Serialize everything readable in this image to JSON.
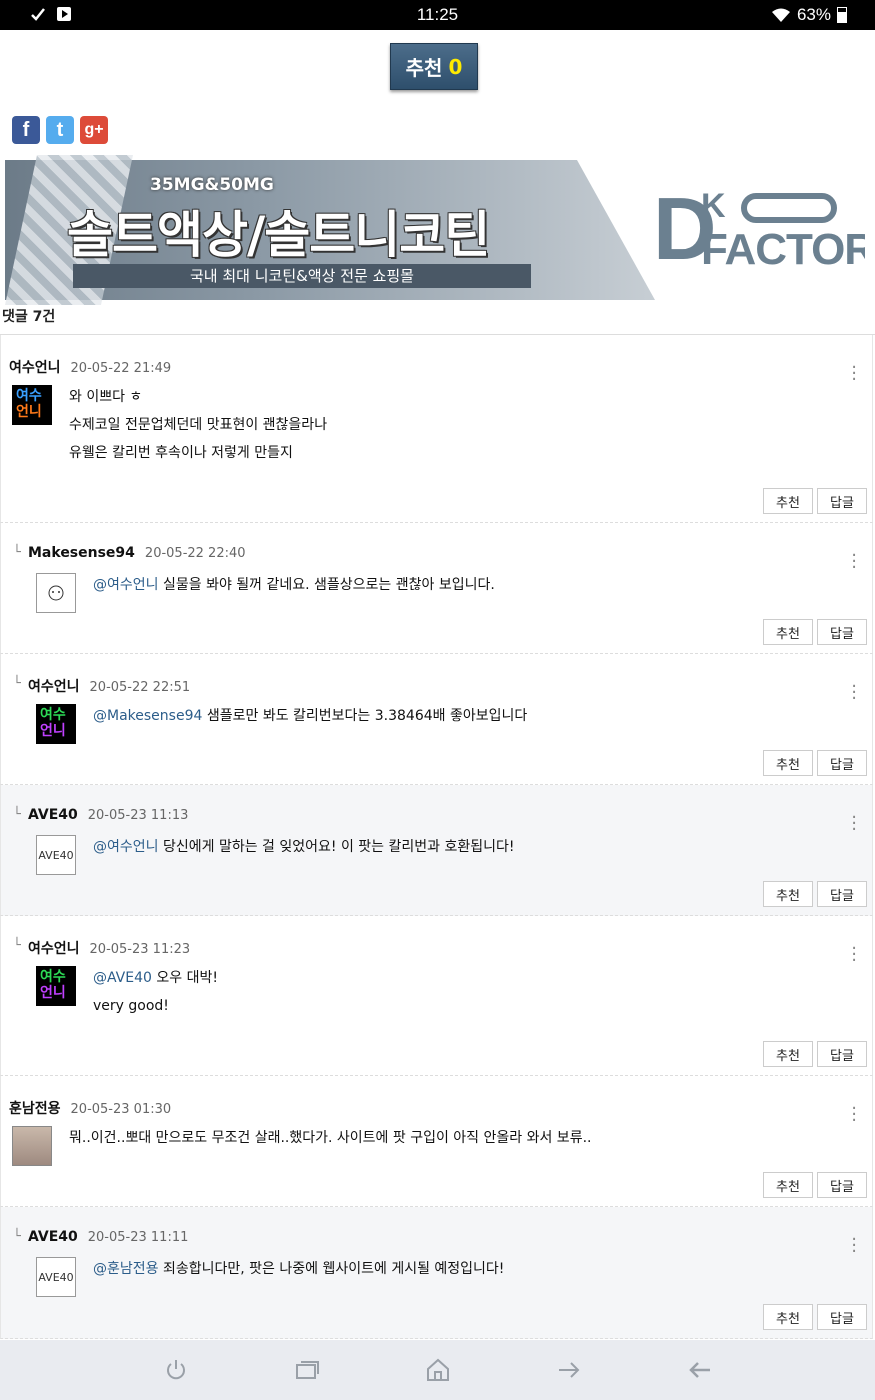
{
  "status_bar": {
    "time": "11:25",
    "battery": "63%"
  },
  "recommend_button": {
    "label": "추천",
    "count": "0"
  },
  "social": {
    "facebook": "f",
    "twitter": "t",
    "googleplus": "g+"
  },
  "banner": {
    "subtitle": "35MG&50MG",
    "title": "솔트액상/솔트니코틴",
    "tagline": "국내 최대 니코틴&액상 전문 쇼핑몰",
    "logo_d": "D",
    "logo_k": "K",
    "logo_factory": "FACTORY"
  },
  "comment_count_label": "댓글 7건",
  "buttons": {
    "recommend": "추천",
    "reply": "답글"
  },
  "comments": [
    {
      "name": "여수언니",
      "date": "20-05-22 21:49",
      "reply": false,
      "lines": [
        "와 이쁘다 ㅎ",
        "수제코일 전문업체던데 맛표현이 괜찮을라나",
        "유웰은 칼리번 후속이나 저렇게 만들지"
      ]
    },
    {
      "name": "Makesense94",
      "date": "20-05-22 22:40",
      "reply": true,
      "mention": "@여수언니",
      "text": "실물을 봐야 될꺼 같네요. 샘플상으로는 괜찮아 보입니다."
    },
    {
      "name": "여수언니",
      "date": "20-05-22 22:51",
      "reply": true,
      "mention": "@Makesense94",
      "text": "샘플로만 봐도 칼리번보다는 3.38464배 좋아보입니다"
    },
    {
      "name": "AVE40",
      "date": "20-05-23 11:13",
      "reply": true,
      "mention": "@여수언니",
      "text": "당신에게 말하는 걸 잊었어요! 이 팟는 칼리번과 호환됩니다!"
    },
    {
      "name": "여수언니",
      "date": "20-05-23 11:23",
      "reply": true,
      "mention": "@AVE40",
      "text": "오우 대박!",
      "line2": "very good!"
    },
    {
      "name": "훈남전용",
      "date": "20-05-23 01:30",
      "reply": false,
      "text": "뭐..이건..뽀대 만으로도 무조건 살래..했다가. 사이트에 팟 구입이 아직 안올라 와서 보류.."
    },
    {
      "name": "AVE40",
      "date": "20-05-23 11:11",
      "reply": true,
      "mention": "@훈남전용",
      "text": "죄송합니다만, 팟은 나중에 웹사이트에 게시될 예정입니다!"
    }
  ],
  "avatar_text": {
    "yeosu_top": "여수",
    "yeosu_bottom": "언니",
    "ave": "AVE40"
  },
  "reply_marker": "└",
  "nav": [
    "power-icon",
    "recent-apps-icon",
    "home-icon",
    "forward-icon",
    "back-icon"
  ]
}
